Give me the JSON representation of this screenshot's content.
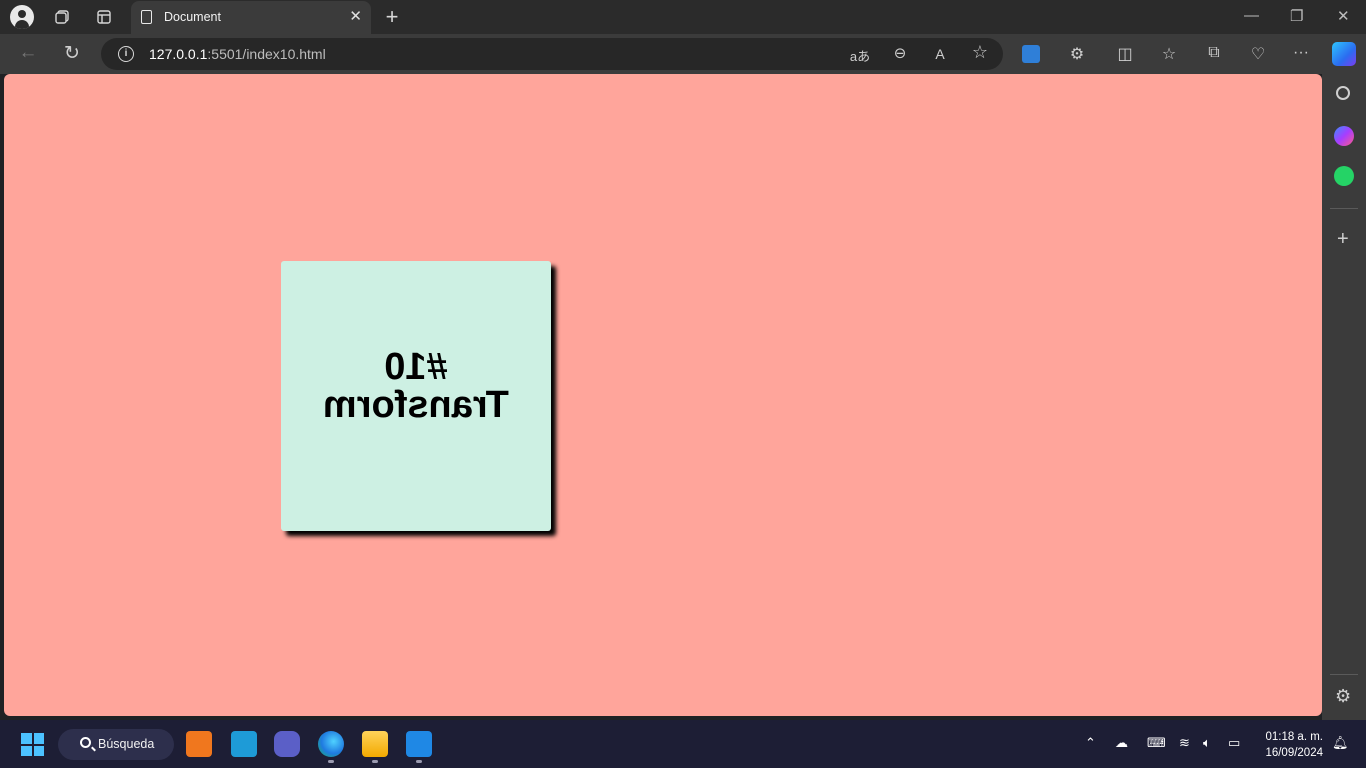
{
  "browser": {
    "tab_title": "Document",
    "url_host": "127.0.0.1",
    "url_path": ":5501/index10.html"
  },
  "page": {
    "card_line1": "#10",
    "card_line2": "Transform",
    "background_color": "#ffa59b",
    "card_color": "#cdf0e3"
  },
  "taskbar": {
    "search_label": "Búsqueda",
    "time": "01:18 a. m.",
    "date": "16/09/2024"
  }
}
